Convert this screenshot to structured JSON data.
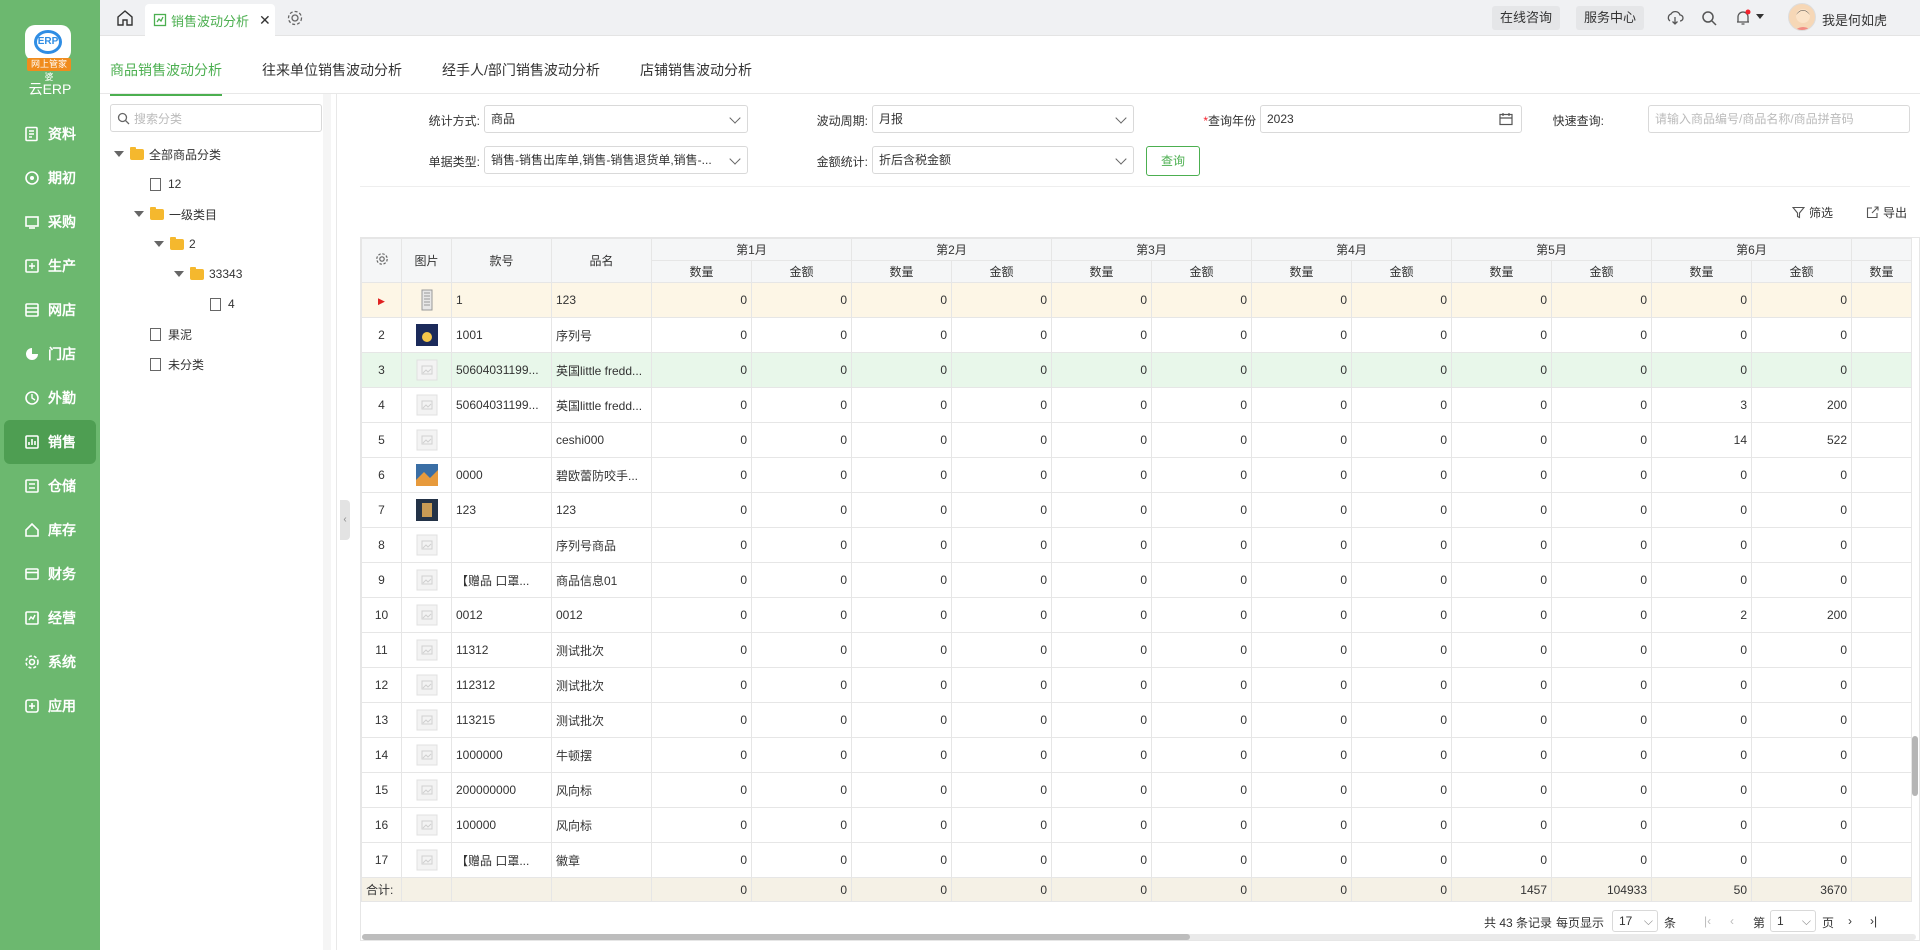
{
  "brand": {
    "logo_text": "云ERP",
    "logo_badge": "ERP",
    "logo_ribbon": "网上管家婆"
  },
  "nav": [
    {
      "label": "资料",
      "icon": "data-icon"
    },
    {
      "label": "期初",
      "icon": "initial-icon"
    },
    {
      "label": "采购",
      "icon": "purchase-icon"
    },
    {
      "label": "生产",
      "icon": "production-icon"
    },
    {
      "label": "网店",
      "icon": "online-store-icon"
    },
    {
      "label": "门店",
      "icon": "store-icon"
    },
    {
      "label": "外勤",
      "icon": "field-icon"
    },
    {
      "label": "销售",
      "icon": "sales-icon"
    },
    {
      "label": "仓储",
      "icon": "warehouse-icon"
    },
    {
      "label": "库存",
      "icon": "inventory-icon"
    },
    {
      "label": "财务",
      "icon": "finance-icon"
    },
    {
      "label": "经营",
      "icon": "operation-icon"
    },
    {
      "label": "系统",
      "icon": "system-icon"
    },
    {
      "label": "应用",
      "icon": "apps-icon"
    }
  ],
  "topbar": {
    "tab_label": "销售波动分析",
    "online_consult": "在线咨询",
    "service_center": "服务中心",
    "username": "我是何如虎"
  },
  "subtabs": [
    "商品销售波动分析",
    "往来单位销售波动分析",
    "经手人/部门销售波动分析",
    "店铺销售波动分析"
  ],
  "tree": {
    "search_placeholder": "搜索分类",
    "nodes": [
      {
        "label": "全部商品分类",
        "type": "folder",
        "expanded": true
      },
      {
        "label": "12",
        "type": "file"
      },
      {
        "label": "一级类目",
        "type": "folder",
        "expanded": true
      },
      {
        "label": "2",
        "type": "folder",
        "expanded": true
      },
      {
        "label": "33343",
        "type": "folder",
        "expanded": true
      },
      {
        "label": "4",
        "type": "file"
      },
      {
        "label": "果泥",
        "type": "file"
      },
      {
        "label": "未分类",
        "type": "file"
      }
    ]
  },
  "filters": {
    "stat_mode_label": "统计方式:",
    "stat_mode_value": "商品",
    "period_label": "波动周期:",
    "period_value": "月报",
    "year_label": "查询年份",
    "year_value": "2023",
    "quick_label": "快速查询:",
    "quick_placeholder": "请输入商品编号/商品名称/商品拼音码",
    "doc_type_label": "单据类型:",
    "doc_type_value": "销售-销售出库单,销售-销售退货单,销售-...",
    "amount_label": "金额统计:",
    "amount_value": "折后含税金额",
    "query_button": "查询"
  },
  "tools": {
    "filter": "筛选",
    "export": "导出"
  },
  "table": {
    "headers": {
      "pic": "图片",
      "code": "款号",
      "name": "品名",
      "qty": "数量",
      "amt": "金额"
    },
    "months": [
      "第1月",
      "第2月",
      "第3月",
      "第4月",
      "第5月",
      "第6月"
    ],
    "rows": [
      {
        "no": "1",
        "code": "1",
        "name": "123",
        "vals": [
          "0",
          "0",
          "0",
          "0",
          "0",
          "0",
          "0",
          "0",
          "0",
          "0",
          "0",
          "0"
        ]
      },
      {
        "no": "2",
        "code": "1001",
        "name": "序列号",
        "vals": [
          "0",
          "0",
          "0",
          "0",
          "0",
          "0",
          "0",
          "0",
          "0",
          "0",
          "0",
          "0"
        ]
      },
      {
        "no": "3",
        "code": "50604031199...",
        "name": "英国little fredd...",
        "vals": [
          "0",
          "0",
          "0",
          "0",
          "0",
          "0",
          "0",
          "0",
          "0",
          "0",
          "0",
          "0"
        ]
      },
      {
        "no": "4",
        "code": "50604031199...",
        "name": "英国little fredd...",
        "vals": [
          "0",
          "0",
          "0",
          "0",
          "0",
          "0",
          "0",
          "0",
          "0",
          "0",
          "3",
          "200"
        ]
      },
      {
        "no": "5",
        "code": "",
        "name": "ceshi000",
        "vals": [
          "0",
          "0",
          "0",
          "0",
          "0",
          "0",
          "0",
          "0",
          "0",
          "0",
          "14",
          "522"
        ]
      },
      {
        "no": "6",
        "code": "0000",
        "name": "碧欧蕾防咬手...",
        "vals": [
          "0",
          "0",
          "0",
          "0",
          "0",
          "0",
          "0",
          "0",
          "0",
          "0",
          "0",
          "0"
        ]
      },
      {
        "no": "7",
        "code": "123",
        "name": "123",
        "vals": [
          "0",
          "0",
          "0",
          "0",
          "0",
          "0",
          "0",
          "0",
          "0",
          "0",
          "0",
          "0"
        ]
      },
      {
        "no": "8",
        "code": "",
        "name": "序列号商品",
        "vals": [
          "0",
          "0",
          "0",
          "0",
          "0",
          "0",
          "0",
          "0",
          "0",
          "0",
          "0",
          "0"
        ]
      },
      {
        "no": "9",
        "code": "【赠品 口罩...",
        "name": "商品信息01",
        "vals": [
          "0",
          "0",
          "0",
          "0",
          "0",
          "0",
          "0",
          "0",
          "0",
          "0",
          "0",
          "0"
        ]
      },
      {
        "no": "10",
        "code": "0012",
        "name": "0012",
        "vals": [
          "0",
          "0",
          "0",
          "0",
          "0",
          "0",
          "0",
          "0",
          "0",
          "0",
          "2",
          "200"
        ]
      },
      {
        "no": "11",
        "code": "11312",
        "name": "测试批次",
        "vals": [
          "0",
          "0",
          "0",
          "0",
          "0",
          "0",
          "0",
          "0",
          "0",
          "0",
          "0",
          "0"
        ]
      },
      {
        "no": "12",
        "code": "112312",
        "name": "测试批次",
        "vals": [
          "0",
          "0",
          "0",
          "0",
          "0",
          "0",
          "0",
          "0",
          "0",
          "0",
          "0",
          "0"
        ]
      },
      {
        "no": "13",
        "code": "113215",
        "name": "测试批次",
        "vals": [
          "0",
          "0",
          "0",
          "0",
          "0",
          "0",
          "0",
          "0",
          "0",
          "0",
          "0",
          "0"
        ]
      },
      {
        "no": "14",
        "code": "1000000",
        "name": "牛顿摆",
        "vals": [
          "0",
          "0",
          "0",
          "0",
          "0",
          "0",
          "0",
          "0",
          "0",
          "0",
          "0",
          "0"
        ]
      },
      {
        "no": "15",
        "code": "200000000",
        "name": "风向标",
        "vals": [
          "0",
          "0",
          "0",
          "0",
          "0",
          "0",
          "0",
          "0",
          "0",
          "0",
          "0",
          "0"
        ]
      },
      {
        "no": "16",
        "code": "100000",
        "name": "风向标",
        "vals": [
          "0",
          "0",
          "0",
          "0",
          "0",
          "0",
          "0",
          "0",
          "0",
          "0",
          "0",
          "0"
        ]
      },
      {
        "no": "17",
        "code": "【赠品 口罩...",
        "name": "徽章",
        "vals": [
          "0",
          "0",
          "0",
          "0",
          "0",
          "0",
          "0",
          "0",
          "0",
          "0",
          "0",
          "0"
        ]
      }
    ],
    "total_label": "合计:",
    "totals": [
      "0",
      "0",
      "0",
      "0",
      "0",
      "0",
      "0",
      "0",
      "1457",
      "104933",
      "50",
      "3670"
    ],
    "next_col_header": "数量"
  },
  "pager": {
    "records": "共 43 条记录",
    "per_page_label": "每页显示",
    "per_page": "17",
    "unit": "条",
    "page_prefix": "第",
    "page": "1",
    "page_suffix": "页"
  },
  "colors": {
    "accent": "#4caf50",
    "sidebar": "#6cb86f",
    "selected_row": "#fdf6e6",
    "highlight_row": "#e8f7ea"
  }
}
